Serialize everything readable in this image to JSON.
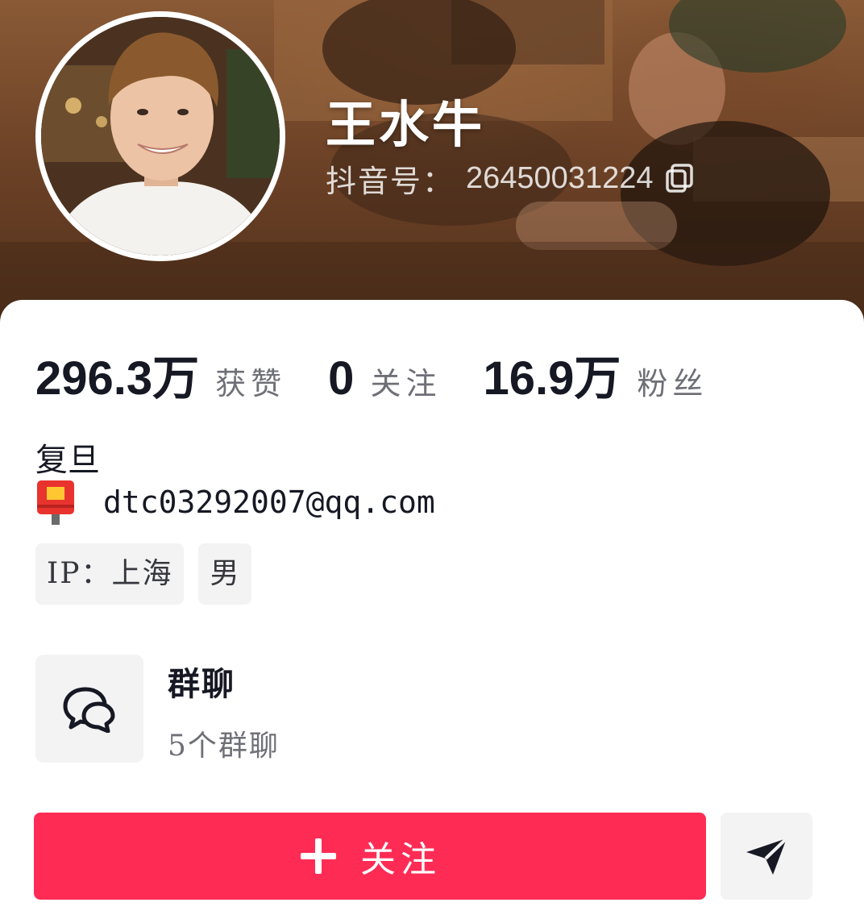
{
  "profile": {
    "display_name": "王水牛",
    "account_label": "抖音号：",
    "account_id": "26450031224",
    "icons": {
      "copy": "copy-icon",
      "avatar": "avatar-photo",
      "cover": "cover-photo"
    }
  },
  "stats": [
    {
      "value": "296.3万",
      "label": "获赞"
    },
    {
      "value": "0",
      "label": "关注"
    },
    {
      "value": "16.9万",
      "label": "粉丝"
    }
  ],
  "bio": {
    "line1": "复旦",
    "contact_icon": "mailbox-icon",
    "contact_email": "dtc03292007@qq.com"
  },
  "tags": [
    {
      "text": "IP：上海"
    },
    {
      "text": "男"
    }
  ],
  "group_chat": {
    "icon": "chat-bubbles-icon",
    "title": "群聊",
    "subtitle": "5个群聊"
  },
  "actions": {
    "follow_icon": "plus-icon",
    "follow_label": "关注",
    "share_icon": "send-icon"
  },
  "colors": {
    "accent": "#fe2c55",
    "text_primary": "#161823",
    "text_secondary": "#6f7077",
    "chip_bg": "#f3f3f4"
  }
}
